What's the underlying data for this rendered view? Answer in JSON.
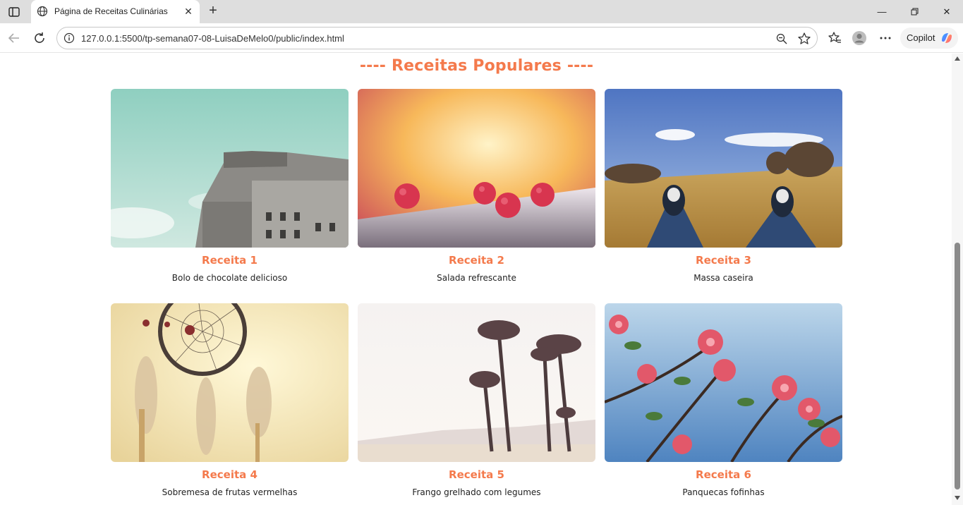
{
  "browser": {
    "tab_title": "Página de Receitas Culinárias",
    "url": "127.0.0.1:5500/tp-semana07-08-LuisaDeMelo0/public/index.html",
    "copilot_label": "Copilot"
  },
  "page": {
    "heading": "---- Receitas Populares ----",
    "recipes": [
      {
        "title": "Receita 1",
        "description": "Bolo de chocolate delicioso",
        "image": "building-photo"
      },
      {
        "title": "Receita 2",
        "description": "Salada refrescante",
        "image": "raspberries-photo"
      },
      {
        "title": "Receita 3",
        "description": "Massa caseira",
        "image": "field-sneakers-photo"
      },
      {
        "title": "Receita 4",
        "description": "Sobremesa de frutas vermelhas",
        "image": "dreamcatcher-photo"
      },
      {
        "title": "Receita 5",
        "description": "Frango grelhado com legumes",
        "image": "palm-trees-photo"
      },
      {
        "title": "Receita 6",
        "description": "Panquecas fofinhas",
        "image": "pink-flowers-photo"
      }
    ]
  },
  "colors": {
    "accent": "#f47a4c",
    "tabstrip": "#dedede"
  }
}
